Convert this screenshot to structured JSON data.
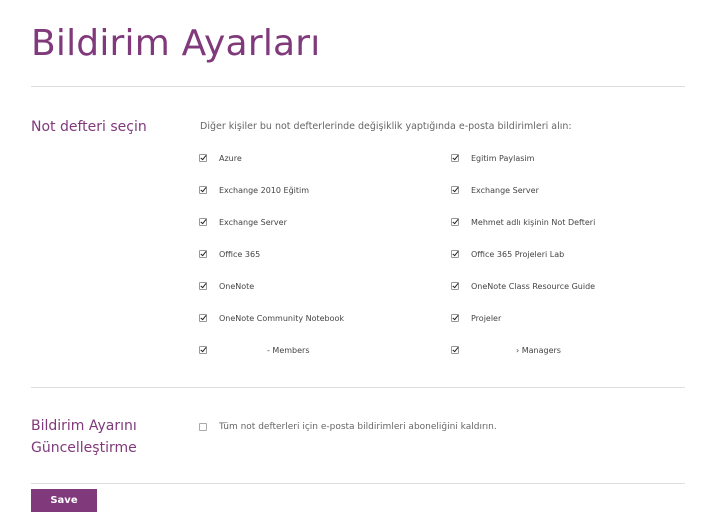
{
  "page": {
    "title": "Bildirim Ayarları"
  },
  "notebooks_section": {
    "label": "Not defteri seçin",
    "description": "Diğer kişiler bu not defterlerinde değişiklik yaptığında e-posta bildirimleri alın:",
    "items": [
      {
        "label": "Azure",
        "checked": true
      },
      {
        "label": "Egitim Paylasim",
        "checked": true
      },
      {
        "label": "Exchange 2010 Eğitim",
        "checked": true
      },
      {
        "label": "Exchange Server",
        "checked": true
      },
      {
        "label": "Exchange Server",
        "checked": true
      },
      {
        "label": "Mehmet adlı kişinin Not Defteri",
        "checked": true
      },
      {
        "label": "Office 365",
        "checked": true
      },
      {
        "label": "Office 365 Projeleri Lab",
        "checked": true
      },
      {
        "label": "OneNote",
        "checked": true
      },
      {
        "label": "OneNote Class Resource Guide",
        "checked": true
      },
      {
        "label": "OneNote Community Notebook",
        "checked": true
      },
      {
        "label": "Projeler",
        "checked": true
      },
      {
        "label": "- Members",
        "checked": true
      },
      {
        "label": "› Managers",
        "checked": true
      }
    ]
  },
  "update_section": {
    "label_line1": "Bildirim Ayarını",
    "label_line2": "Güncelleştirme",
    "unsubscribe_label": "Tüm not defterleri için e-posta bildirimleri aboneliğini kaldırın.",
    "unsubscribe_checked": false
  },
  "actions": {
    "save_label": "Save"
  },
  "colors": {
    "accent": "#80397b"
  }
}
